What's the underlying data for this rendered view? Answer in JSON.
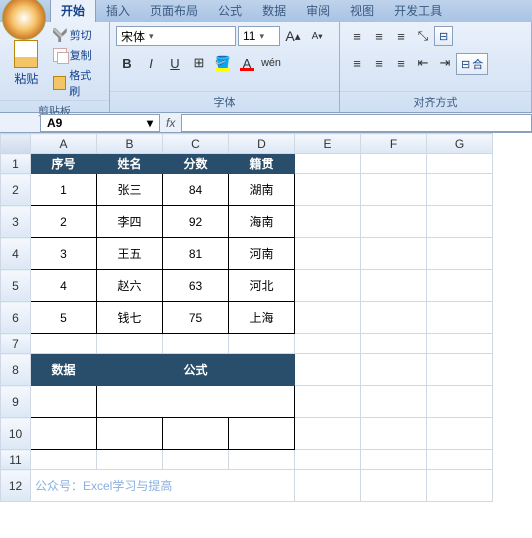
{
  "tabs": {
    "t0": "开始",
    "t1": "插入",
    "t2": "页面布局",
    "t3": "公式",
    "t4": "数据",
    "t5": "审阅",
    "t6": "视图",
    "t7": "开发工具"
  },
  "clipboard": {
    "paste": "粘贴",
    "cut": "剪切",
    "copy": "复制",
    "fmt": "格式刷",
    "title": "剪贴板"
  },
  "font": {
    "name": "宋体",
    "size": "11",
    "title": "字体"
  },
  "align": {
    "merge": "合",
    "title": "对齐方式"
  },
  "namebox": "A9",
  "headers": {
    "A": "A",
    "B": "B",
    "C": "C",
    "D": "D",
    "E": "E",
    "F": "F",
    "G": "G"
  },
  "table1": {
    "h1": "序号",
    "h2": "姓名",
    "h3": "分数",
    "h4": "籍贯",
    "r": [
      {
        "n": "1",
        "name": "张三",
        "score": "84",
        "place": "湖南"
      },
      {
        "n": "2",
        "name": "李四",
        "score": "92",
        "place": "海南"
      },
      {
        "n": "3",
        "name": "王五",
        "score": "81",
        "place": "河南"
      },
      {
        "n": "4",
        "name": "赵六",
        "score": "63",
        "place": "河北"
      },
      {
        "n": "5",
        "name": "钱七",
        "score": "75",
        "place": "上海"
      }
    ]
  },
  "table2": {
    "h1": "数据",
    "h2": "公式"
  },
  "watermark": "公众号：Excel学习与提高"
}
